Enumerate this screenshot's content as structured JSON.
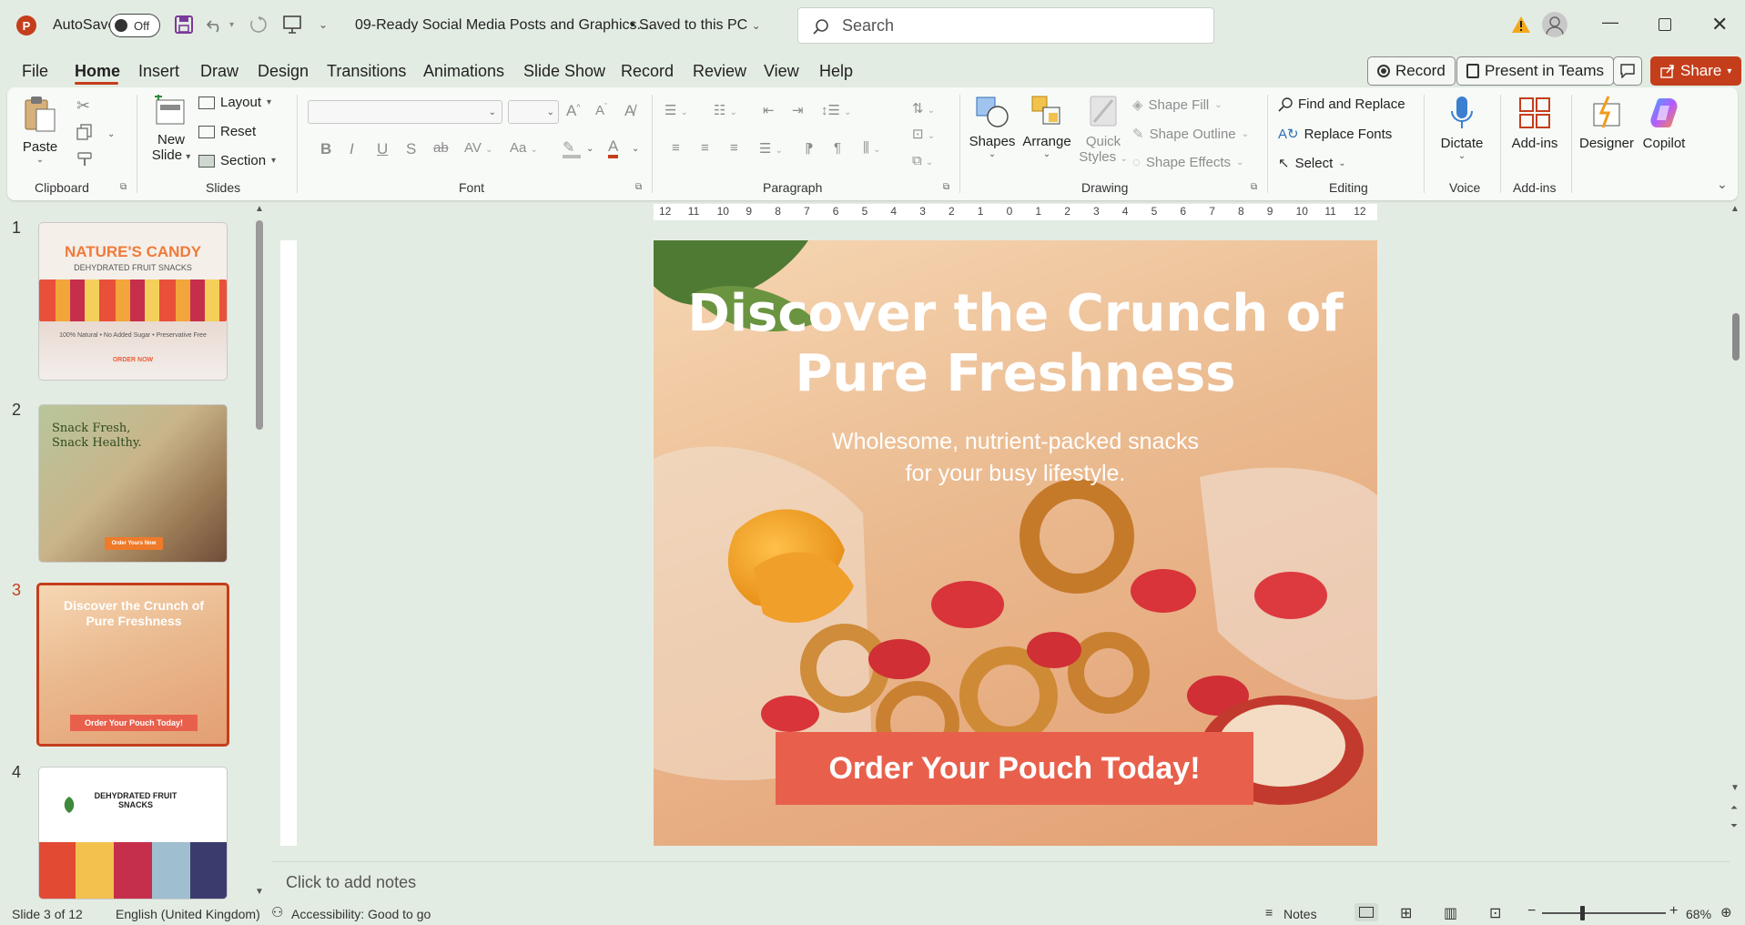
{
  "app": {
    "autosave_label": "AutoSave",
    "autosave_state": "Off",
    "file_title": "09-Ready Social Media Posts and Graphics....",
    "save_status": "Saved to this PC",
    "search_placeholder": "Search",
    "accent_color": "#c43e1c"
  },
  "tabs": [
    "File",
    "Home",
    "Insert",
    "Draw",
    "Design",
    "Transitions",
    "Animations",
    "Slide Show",
    "Record",
    "Review",
    "View",
    "Help"
  ],
  "active_tab": "Home",
  "top_right": {
    "record": "Record",
    "present": "Present in Teams",
    "share": "Share"
  },
  "ribbon": {
    "clipboard": {
      "paste": "Paste",
      "label": "Clipboard"
    },
    "slides": {
      "new_slide_1": "New",
      "new_slide_2": "Slide",
      "layout": "Layout",
      "reset": "Reset",
      "section": "Section",
      "label": "Slides"
    },
    "font": {
      "label": "Font"
    },
    "paragraph": {
      "label": "Paragraph"
    },
    "drawing": {
      "shapes": "Shapes",
      "arrange": "Arrange",
      "quick_1": "Quick",
      "quick_2": "Styles",
      "shape_fill": "Shape Fill",
      "shape_outline": "Shape Outline",
      "shape_effects": "Shape Effects",
      "label": "Drawing"
    },
    "editing": {
      "find_replace": "Find and Replace",
      "replace_fonts": "Replace Fonts",
      "select": "Select",
      "label": "Editing"
    },
    "voice": {
      "dictate": "Dictate",
      "label": "Voice"
    },
    "addins": {
      "addins": "Add-ins",
      "label": "Add-ins"
    },
    "designer": "Designer",
    "copilot": "Copilot"
  },
  "thumbnails": [
    {
      "num": "1",
      "title": "NATURE'S CANDY",
      "subtitle": "DEHYDRATED FRUIT SNACKS",
      "line": "100% Natural • No Added Sugar • Preservative Free",
      "cta": "ORDER NOW"
    },
    {
      "num": "2",
      "title": "Snack Fresh, Snack Healthy.",
      "cta": "Order Yours Now"
    },
    {
      "num": "3",
      "title": "Discover the Crunch of Pure Freshness",
      "cta": "Order Your Pouch Today!"
    },
    {
      "num": "4",
      "title": "DEHYDRATED FRUIT SNACKS"
    }
  ],
  "slide": {
    "title": "Discover the Crunch of Pure Freshness",
    "subtitle_1": "Wholesome, nutrient-packed snacks",
    "subtitle_2": "for your busy lifestyle.",
    "cta": "Order Your Pouch Today!"
  },
  "ruler_h_ticks": [
    "12",
    "11",
    "10",
    "9",
    "8",
    "7",
    "6",
    "5",
    "4",
    "3",
    "2",
    "1",
    "0",
    "1",
    "2",
    "3",
    "4",
    "5",
    "6",
    "7",
    "8",
    "9",
    "10",
    "11",
    "12"
  ],
  "notes_placeholder": "Click to add notes",
  "status": {
    "slide": "Slide 3 of 12",
    "language": "English (United Kingdom)",
    "accessibility": "Accessibility: Good to go",
    "notes": "Notes",
    "zoom": "68%"
  }
}
